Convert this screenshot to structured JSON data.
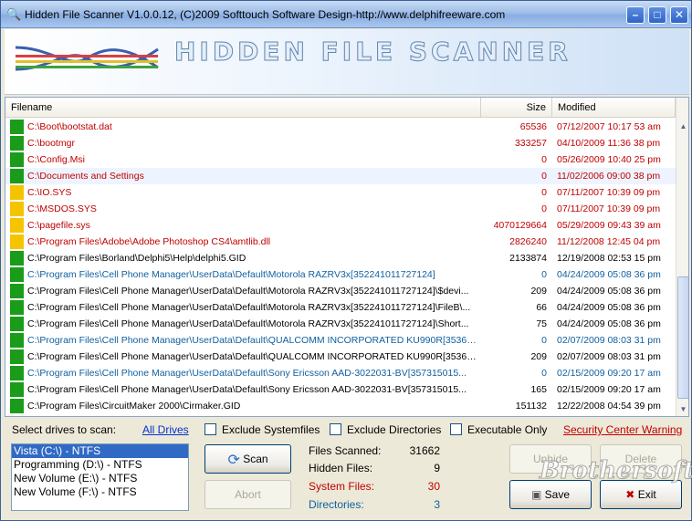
{
  "window": {
    "title": "Hidden File Scanner V1.0.0.12, (C)2009 Softtouch Software Design-http://www.delphifreeware.com"
  },
  "banner": {
    "title": "HIDDEN FILE SCANNER"
  },
  "columns": {
    "filename": "Filename",
    "size": "Size",
    "modified": "Modified"
  },
  "colors": {
    "green": "#1a9c1a",
    "yellow": "#f5c400",
    "red": "#c00000",
    "blue": "#1060a0",
    "black": "#000000"
  },
  "rows": [
    {
      "marker": "green",
      "color": "red",
      "name": "C:\\Boot\\bootstat.dat",
      "size": "65536",
      "modified": "07/12/2007 10:17 53 am"
    },
    {
      "marker": "green",
      "color": "red",
      "name": "C:\\bootmgr",
      "size": "333257",
      "modified": "04/10/2009 11:36 38 pm"
    },
    {
      "marker": "green",
      "color": "red",
      "name": "C:\\Config.Msi",
      "size": "0",
      "modified": "05/26/2009 10:40 25 pm"
    },
    {
      "marker": "green",
      "color": "red",
      "name": "C:\\Documents and Settings",
      "size": "0",
      "modified": "11/02/2006 09:00 38 pm"
    },
    {
      "marker": "yellow",
      "color": "red",
      "name": "C:\\IO.SYS",
      "size": "0",
      "modified": "07/11/2007 10:39 09 pm"
    },
    {
      "marker": "yellow",
      "color": "red",
      "name": "C:\\MSDOS.SYS",
      "size": "0",
      "modified": "07/11/2007 10:39 09 pm"
    },
    {
      "marker": "yellow",
      "color": "red",
      "name": "C:\\pagefile.sys",
      "size": "4070129664",
      "modified": "05/29/2009 09:43 39 am"
    },
    {
      "marker": "yellow",
      "color": "red",
      "name": "C:\\Program Files\\Adobe\\Adobe Photoshop CS4\\amtlib.dll",
      "size": "2826240",
      "modified": "11/12/2008 12:45 04 pm"
    },
    {
      "marker": "green",
      "color": "black",
      "name": "C:\\Program Files\\Borland\\Delphi5\\Help\\delphi5.GID",
      "size": "2133874",
      "modified": "12/19/2008 02:53 15 pm"
    },
    {
      "marker": "green",
      "color": "blue",
      "name": "C:\\Program Files\\Cell Phone Manager\\UserData\\Default\\Motorola RAZRV3x[352241011727124]",
      "size": "0",
      "modified": "04/24/2009 05:08 36 pm"
    },
    {
      "marker": "green",
      "color": "black",
      "name": "C:\\Program Files\\Cell Phone Manager\\UserData\\Default\\Motorola RAZRV3x[352241011727124]\\$devi...",
      "size": "209",
      "modified": "04/24/2009 05:08 36 pm"
    },
    {
      "marker": "green",
      "color": "black",
      "name": "C:\\Program Files\\Cell Phone Manager\\UserData\\Default\\Motorola RAZRV3x[352241011727124]\\FileB\\...",
      "size": "66",
      "modified": "04/24/2009 05:08 36 pm"
    },
    {
      "marker": "green",
      "color": "black",
      "name": "C:\\Program Files\\Cell Phone Manager\\UserData\\Default\\Motorola RAZRV3x[352241011727124]\\Short...",
      "size": "75",
      "modified": "04/24/2009 05:08 36 pm"
    },
    {
      "marker": "green",
      "color": "blue",
      "name": "C:\\Program Files\\Cell Phone Manager\\UserData\\Default\\QUALCOMM INCORPORATED KU990R[35363...",
      "size": "0",
      "modified": "02/07/2009 08:03 31 pm"
    },
    {
      "marker": "green",
      "color": "black",
      "name": "C:\\Program Files\\Cell Phone Manager\\UserData\\Default\\QUALCOMM INCORPORATED KU990R[35363...",
      "size": "209",
      "modified": "02/07/2009 08:03 31 pm"
    },
    {
      "marker": "green",
      "color": "blue",
      "name": "C:\\Program Files\\Cell Phone Manager\\UserData\\Default\\Sony Ericsson AAD-3022031-BV[357315015...",
      "size": "0",
      "modified": "02/15/2009 09:20 17 am"
    },
    {
      "marker": "green",
      "color": "black",
      "name": "C:\\Program Files\\Cell Phone Manager\\UserData\\Default\\Sony Ericsson AAD-3022031-BV[357315015...",
      "size": "165",
      "modified": "02/15/2009 09:20 17 am"
    },
    {
      "marker": "green",
      "color": "black",
      "name": "C:\\Program Files\\CircuitMaker 2000\\Cirmaker.GID",
      "size": "151132",
      "modified": "12/22/2008 04:54 39 pm"
    }
  ],
  "controls": {
    "select_drives_label": "Select drives to scan:",
    "all_drives": "All Drives",
    "exclude_systemfiles": "Exclude Systemfiles",
    "exclude_directories": "Exclude Directories",
    "executable_only": "Executable Only",
    "security_warning": "Security Center Warning",
    "drives": [
      "Vista (C:\\) - NTFS",
      "Programming (D:\\) - NTFS",
      "New Volume (E:\\) - NTFS",
      "New Volume (F:\\) - NTFS"
    ],
    "scan": "Scan",
    "abort": "Abort",
    "unhide": "Unhide",
    "delete": "Delete",
    "save": "Save",
    "exit": "Exit"
  },
  "stats": {
    "files_scanned_label": "Files Scanned:",
    "files_scanned": "31662",
    "hidden_files_label": "Hidden Files:",
    "hidden_files": "9",
    "system_files_label": "System Files:",
    "system_files": "30",
    "directories_label": "Directories:",
    "directories": "3"
  },
  "watermark": "Brothersoft"
}
